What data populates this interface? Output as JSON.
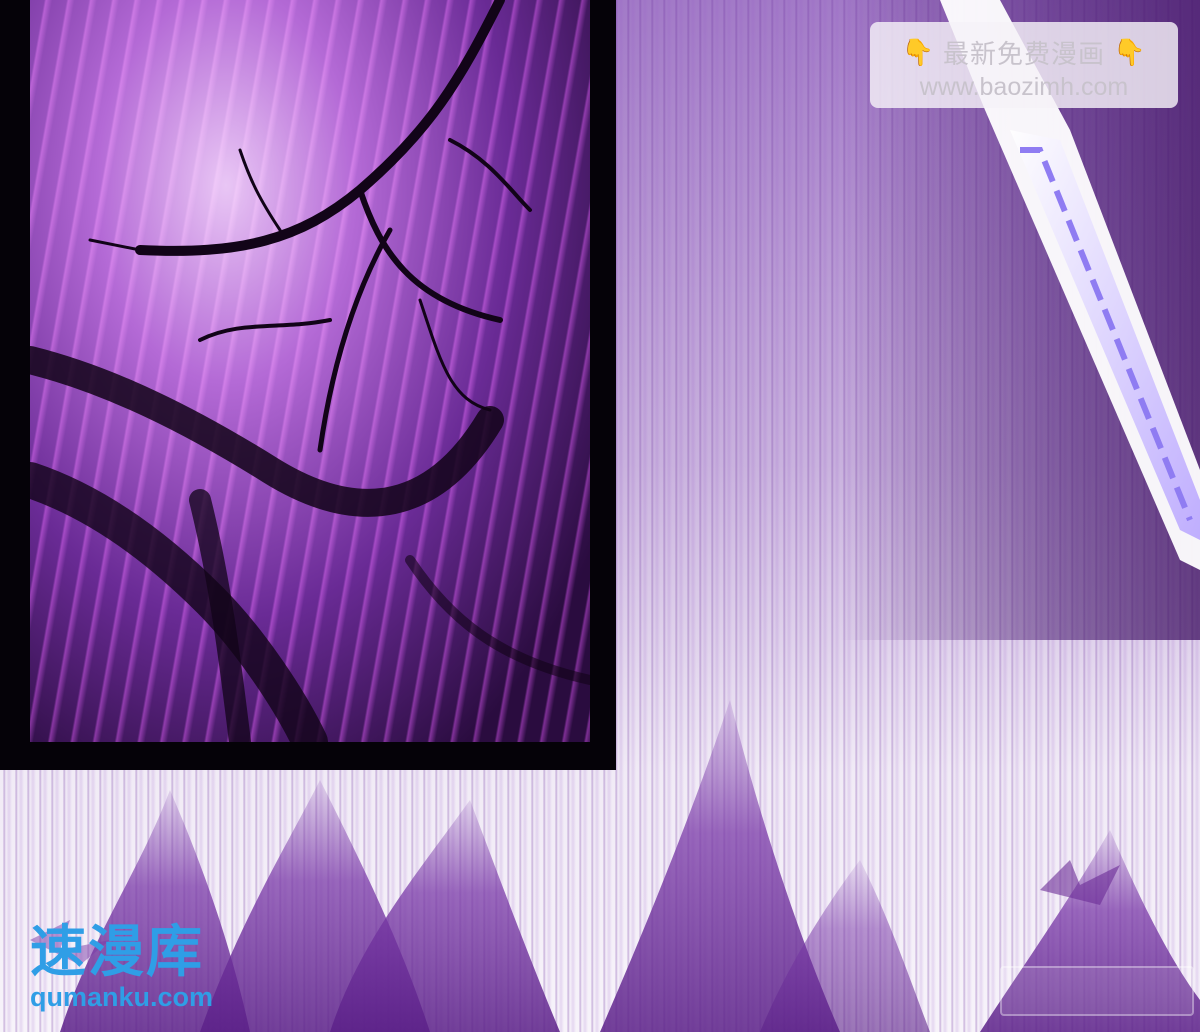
{
  "watermark_top": {
    "line1": "最新免费漫画",
    "line2": "www.baozimh.com",
    "left_icon": "pointing-down-hand-icon",
    "right_icon": "pointing-down-hand-icon"
  },
  "watermark_bottom": {
    "title": "速漫库",
    "url": "qumanku.com",
    "color": "#2f9ee6"
  },
  "colors": {
    "panel_border": "#050208",
    "purple_dark": "#2a0c3f",
    "purple_mid": "#8a3fbf",
    "purple_light": "#e9c6f5"
  }
}
